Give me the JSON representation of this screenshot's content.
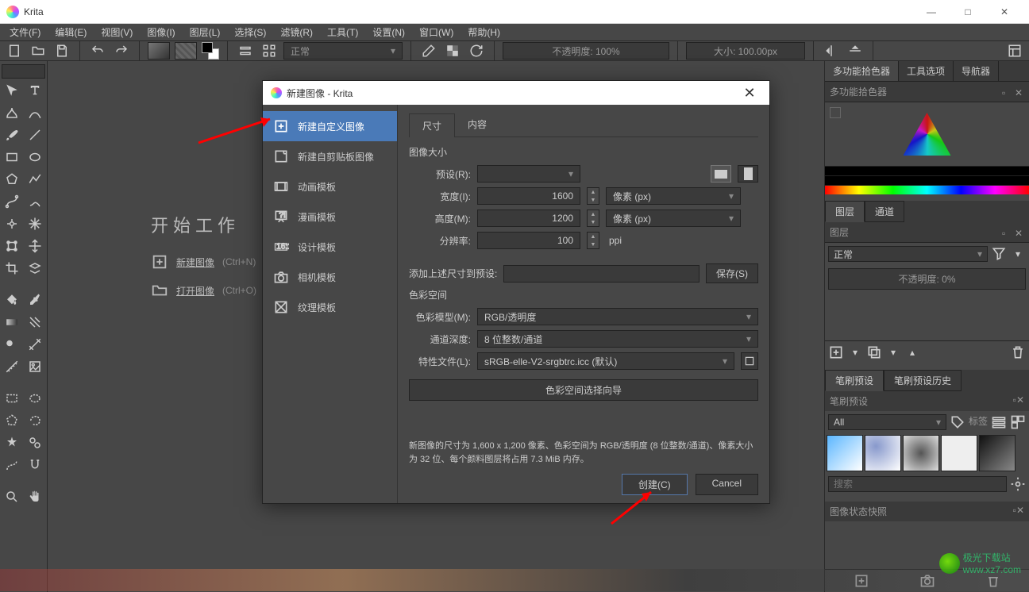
{
  "window": {
    "title": "Krita"
  },
  "winbtns": {
    "min": "—",
    "max": "□",
    "close": "✕"
  },
  "menubar": [
    "文件(F)",
    "编辑(E)",
    "视图(V)",
    "图像(I)",
    "图层(L)",
    "选择(S)",
    "滤镜(R)",
    "工具(T)",
    "设置(N)",
    "窗口(W)",
    "帮助(H)"
  ],
  "toolbar": {
    "blend_mode": "正常",
    "opacity_label": "不透明度:  100%",
    "size_label": "大小:  100.00px"
  },
  "start": {
    "title": "开始工作",
    "new_image": "新建图像",
    "new_shortcut": "(Ctrl+N)",
    "open_image": "打开图像",
    "open_shortcut": "(Ctrl+O)"
  },
  "right": {
    "tabs": [
      "多功能拾色器",
      "工具选项",
      "导航器"
    ],
    "picker_label": "多功能拾色器",
    "layer_tabs": [
      "图层",
      "通道"
    ],
    "layer_label": "图层",
    "blend": "正常",
    "opacity": "不透明度:    0%",
    "brush_tabs": [
      "笔刷预设",
      "笔刷预设历史"
    ],
    "brush_label": "笔刷预设",
    "brush_filter_all": "All",
    "brush_tag": "标签",
    "search_placeholder": "搜索",
    "snapshot": "图像状态快照"
  },
  "dialog": {
    "title": "新建图像 - Krita",
    "side": [
      "新建自定义图像",
      "新建自剪贴板图像",
      "动画模板",
      "漫画模板",
      "设计模板",
      "相机模板",
      "纹理模板"
    ],
    "tabs": [
      "尺寸",
      "内容"
    ],
    "image_size": "图像大小",
    "preset_lbl": "预设(R):",
    "width_lbl": "宽度(I):",
    "width_val": "1600",
    "height_lbl": "高度(M):",
    "height_val": "1200",
    "unit": "像素 (px)",
    "res_lbl": "分辨率:",
    "res_val": "100",
    "res_unit": "ppi",
    "save_preset_lbl": "添加上述尺寸到预设:",
    "save_btn": "保存(S)",
    "colorspace": "色彩空间",
    "model_lbl": "色彩模型(M):",
    "model_val": "RGB/透明度",
    "depth_lbl": "通道深度:",
    "depth_val": "8 位整数/通道",
    "profile_lbl": "特性文件(L):",
    "profile_val": "sRGB-elle-V2-srgbtrc.icc (默认)",
    "wizard": "色彩空间选择向导",
    "info": "新图像的尺寸为 1,600 x 1,200 像素、色彩空间为 RGB/透明度 (8 位整数/通道)、像素大小为 32 位、每个颜料图层将占用 7.3 MiB 内存。",
    "create": "创建(C)",
    "cancel": "Cancel"
  },
  "watermark": "极光下载站\nwww.xz7.com"
}
